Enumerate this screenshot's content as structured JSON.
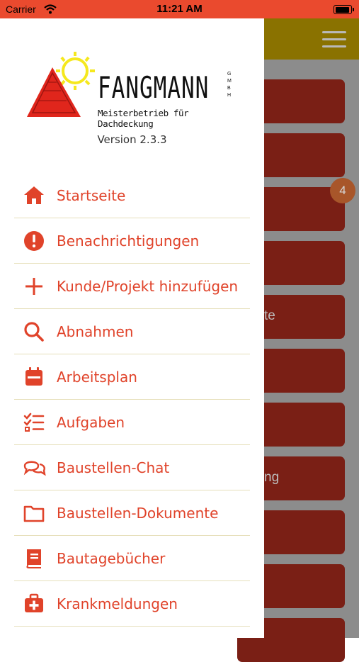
{
  "statusbar": {
    "carrier": "Carrier",
    "time": "11:21 AM"
  },
  "colors": {
    "accent": "#e0432a",
    "statusbar": "#ea4a2e",
    "divider": "#e6dfba"
  },
  "logo": {
    "company": "FANGMANN",
    "legal_form": "GMBH",
    "tagline": "Meisterbetrieb für Dachdeckung"
  },
  "drawer": {
    "version": "Version 2.3.3",
    "items": [
      {
        "label": "Startseite",
        "icon": "home-icon"
      },
      {
        "label": "Benachrichtigungen",
        "icon": "alert-icon"
      },
      {
        "label": "Kunde/Projekt hinzufügen",
        "icon": "plus-icon"
      },
      {
        "label": "Abnahmen",
        "icon": "search-icon"
      },
      {
        "label": "Arbeitsplan",
        "icon": "calendar-icon"
      },
      {
        "label": "Aufgaben",
        "icon": "checklist-icon"
      },
      {
        "label": "Baustellen-Chat",
        "icon": "chat-icon"
      },
      {
        "label": "Baustellen-Dokumente",
        "icon": "folder-icon"
      },
      {
        "label": "Bautagebücher",
        "icon": "book-icon"
      },
      {
        "label": "Krankmeldungen",
        "icon": "medical-kit-icon"
      }
    ]
  },
  "background": {
    "badge_count": "4",
    "tile_fragments": [
      "te",
      "ng"
    ]
  }
}
